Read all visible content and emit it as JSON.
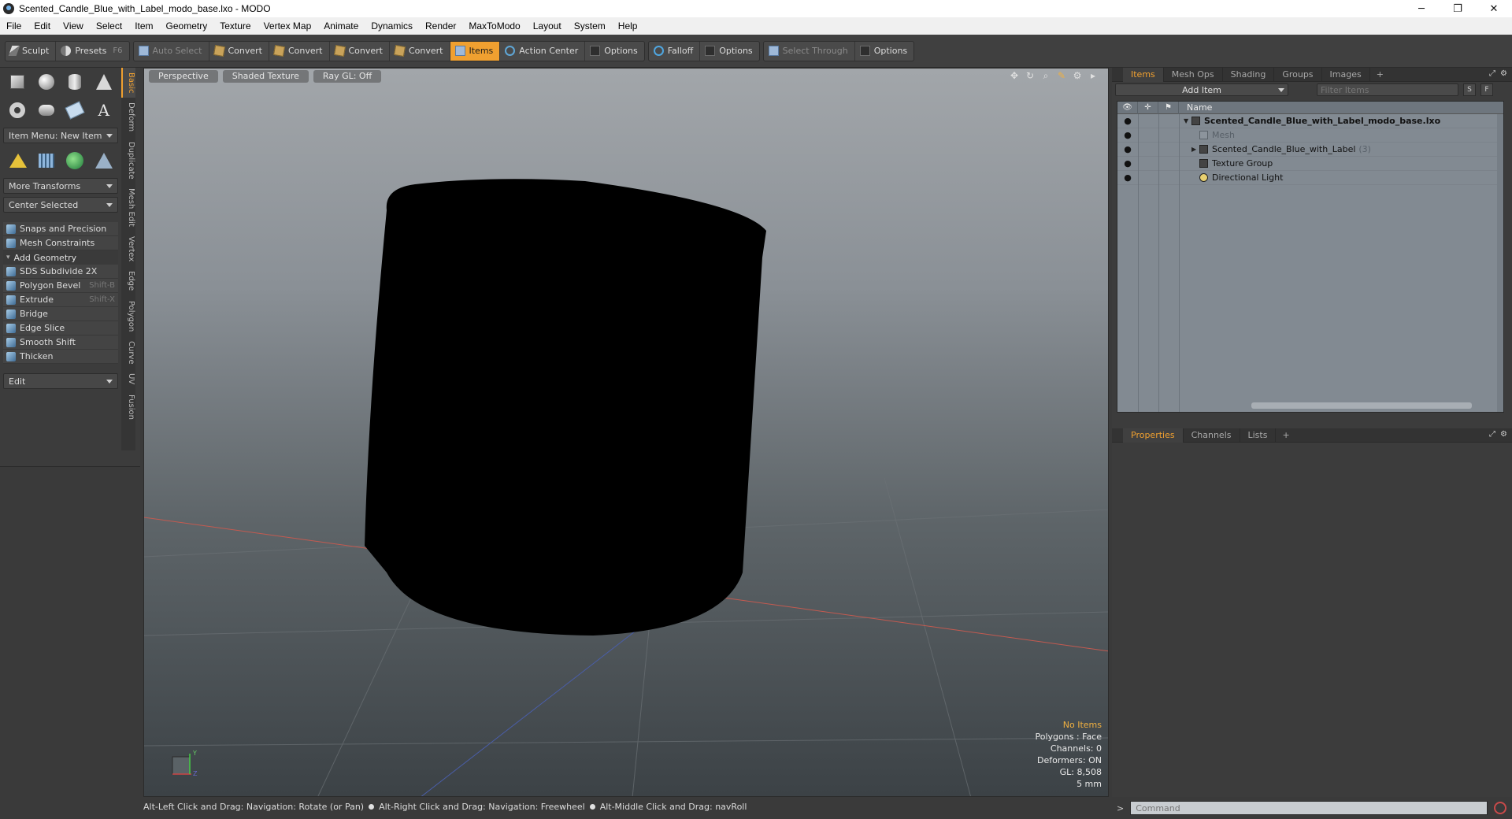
{
  "window": {
    "title": "Scented_Candle_Blue_with_Label_modo_base.lxo - MODO",
    "controls": [
      "─",
      "❐",
      "✕"
    ]
  },
  "menubar": [
    "File",
    "Edit",
    "View",
    "Select",
    "Item",
    "Geometry",
    "Texture",
    "Vertex Map",
    "Animate",
    "Dynamics",
    "Render",
    "MaxToModo",
    "Layout",
    "System",
    "Help"
  ],
  "toolbar": {
    "sculpt": "Sculpt",
    "presets": "Presets",
    "presets_key": "F6",
    "auto_select": "Auto Select",
    "convert_labels": [
      "Convert",
      "Convert",
      "Convert",
      "Convert"
    ],
    "items": "Items",
    "action_center": "Action Center",
    "options1": "Options",
    "falloff": "Falloff",
    "options2": "Options",
    "select_through": "Select Through",
    "options3": "Options"
  },
  "left_panel": {
    "item_menu": "Item Menu: New Item",
    "more_transforms": "More Transforms",
    "center_selected": "Center Selected",
    "snaps": "Snaps and Precision",
    "mesh_constraints": "Mesh Constraints",
    "add_geometry": "Add Geometry",
    "tools": [
      {
        "label": "SDS Subdivide 2X",
        "key": ""
      },
      {
        "label": "Polygon Bevel",
        "key": "Shift-B"
      },
      {
        "label": "Extrude",
        "key": "Shift-X"
      },
      {
        "label": "Bridge",
        "key": ""
      },
      {
        "label": "Edge Slice",
        "key": ""
      },
      {
        "label": "Smooth Shift",
        "key": ""
      },
      {
        "label": "Thicken",
        "key": ""
      }
    ],
    "edit_dropdown": "Edit",
    "vertical_tabs": [
      "Basic",
      "Deform",
      "Duplicate",
      "Mesh Edit",
      "Vertex",
      "Edge",
      "Polygon",
      "Curve",
      "UV",
      "Fusion"
    ]
  },
  "viewport": {
    "tabs": [
      "Perspective",
      "Shaded Texture",
      "Ray GL: Off"
    ],
    "info": {
      "no_items": "No Items",
      "polygons": "Polygons : Face",
      "channels": "Channels: 0",
      "deformers": "Deformers: ON",
      "gl": "GL: 8,508",
      "unit": "5 mm"
    },
    "gizmo_labels": {
      "y": "Y",
      "z": "Z"
    }
  },
  "statusbar": {
    "hints": [
      "Alt-Left Click and Drag: Navigation: Rotate (or Pan)",
      "Alt-Right Click and Drag: Navigation: Freewheel",
      "Alt-Middle Click and Drag: navRoll"
    ]
  },
  "right_panel": {
    "top_tabs": [
      "Items",
      "Mesh Ops",
      "Shading",
      "Groups",
      "Images"
    ],
    "add_item": "Add Item",
    "filter_placeholder": "Filter Items",
    "small_buttons": [
      "S",
      "F"
    ],
    "column_name": "Name",
    "items": [
      {
        "name": "Scented_Candle_Blue_with_Label_modo_base.lxo",
        "count": "",
        "type": "scene",
        "indent": 0
      },
      {
        "name": "Mesh",
        "count": "",
        "type": "mesh-dim",
        "indent": 1
      },
      {
        "name": "Scented_Candle_Blue_with_Label",
        "count": "(3)",
        "type": "group",
        "indent": 1
      },
      {
        "name": "Texture Group",
        "count": "",
        "type": "texture",
        "indent": 1
      },
      {
        "name": "Directional Light",
        "count": "",
        "type": "light",
        "indent": 1
      }
    ],
    "props_tabs": [
      "Properties",
      "Channels",
      "Lists"
    ],
    "command_placeholder": "Command",
    "command_prompt": ">"
  },
  "colors": {
    "accent": "#f0a030",
    "viewport_top": "#a2a6aa",
    "viewport_bottom": "#3c4246",
    "object": "#000000"
  }
}
